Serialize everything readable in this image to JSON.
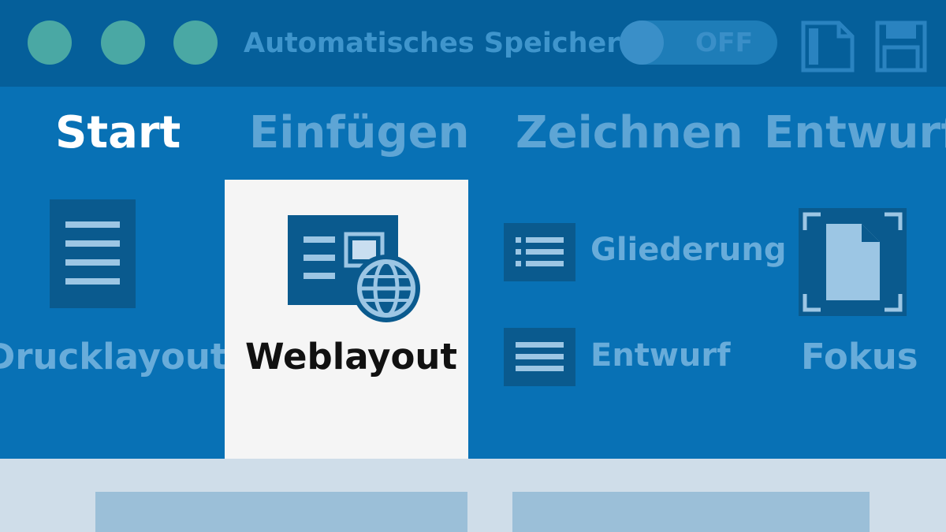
{
  "titlebar": {
    "window_controls": [
      "close",
      "minimize",
      "maximize"
    ],
    "autosave_label": "Automatisches Speichern",
    "autosave_state": "OFF",
    "icons": [
      "document-view-icon",
      "save-icon"
    ]
  },
  "tabs": [
    {
      "label": "Start",
      "active": true
    },
    {
      "label": "Einfügen",
      "active": false
    },
    {
      "label": "Zeichnen",
      "active": false
    },
    {
      "label": "Entwurf",
      "active": false
    }
  ],
  "views": {
    "drucklayout": {
      "label": "Drucklayout",
      "icon": "print-layout-icon"
    },
    "weblayout": {
      "label": "Weblayout",
      "icon": "web-layout-icon",
      "selected": true
    },
    "gliederung": {
      "label": "Gliederung",
      "icon": "outline-icon"
    },
    "entwurf": {
      "label": "Entwurf",
      "icon": "draft-icon"
    },
    "fokus": {
      "label": "Fokus",
      "icon": "focus-icon"
    }
  },
  "colors": {
    "titlebar": "#055f9a",
    "ribbon": "#0871b5",
    "inactive_text": "#5ea5d5",
    "active_text": "#ffffff",
    "selected_card": "#f5f5f5",
    "window_dot": "#4aa8a4",
    "document_bg": "#cfdde9"
  }
}
